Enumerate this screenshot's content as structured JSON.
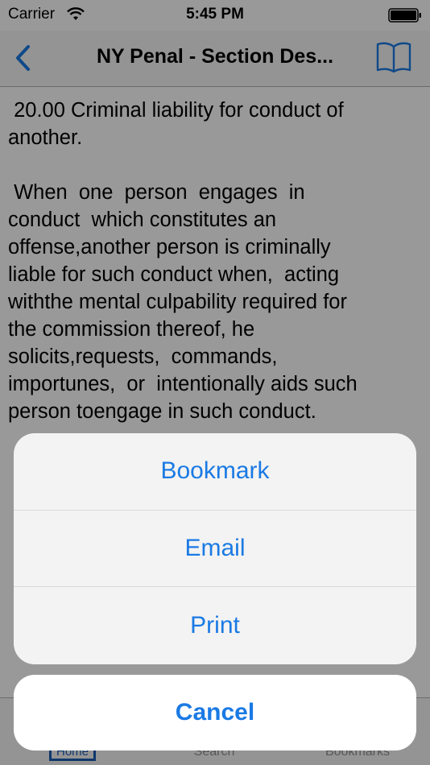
{
  "status_bar": {
    "carrier": "Carrier",
    "time": "5:45 PM"
  },
  "nav_bar": {
    "title": "NY Penal - Section Des..."
  },
  "content": {
    "heading_lines": [
      " 20.00 Criminal liability for conduct of",
      "another."
    ],
    "body_lines": [
      " When  one  person  engages  in",
      "conduct  which constitutes an",
      "offense,another person is criminally",
      "liable for such conduct when,  acting",
      "withthe mental culpability required for",
      "the commission thereof, he",
      "solicits,requests,  commands,",
      "importunes,  or  intentionally aids such",
      "person toengage in such conduct."
    ]
  },
  "tab_bar": {
    "home": "Home",
    "search": "Search",
    "bookmarks": "Bookmarks"
  },
  "action_sheet": {
    "items": [
      "Bookmark",
      "Email",
      "Print"
    ],
    "cancel": "Cancel"
  },
  "colors": {
    "accent": "#1a7ae4",
    "overlay": "rgba(0,0,0,0.40)"
  },
  "icons": {
    "back": "chevron-left-icon",
    "book": "book-icon",
    "wifi": "wifi-icon",
    "battery": "battery-icon"
  }
}
